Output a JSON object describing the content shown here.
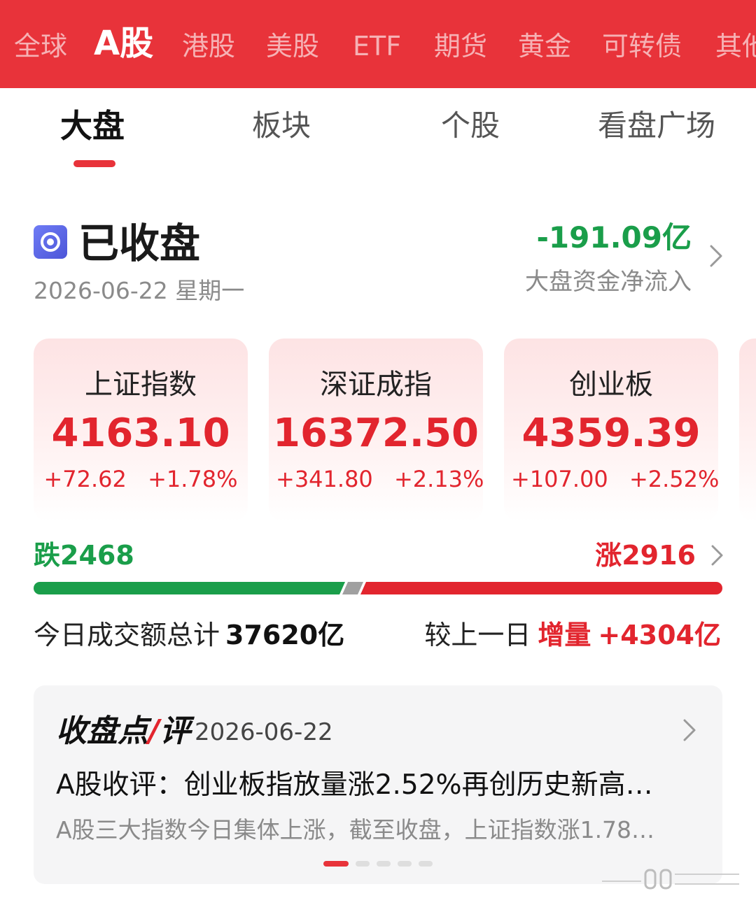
{
  "market_tabs": [
    {
      "label": "全球"
    },
    {
      "label": "A股"
    },
    {
      "label": "港股"
    },
    {
      "label": "美股"
    },
    {
      "label": "ETF"
    },
    {
      "label": "期货"
    },
    {
      "label": "黄金"
    },
    {
      "label": "可转债"
    },
    {
      "label": "其他"
    }
  ],
  "active_market_tab": "A股",
  "sub_tabs": [
    {
      "label": "大盘"
    },
    {
      "label": "板块"
    },
    {
      "label": "个股"
    },
    {
      "label": "看盘广场"
    }
  ],
  "active_sub_tab": "大盘",
  "status": {
    "title": "已收盘",
    "date": "2026-06-22 星期一",
    "icon": "record-icon"
  },
  "fund_flow": {
    "value": "-191.09亿",
    "label": "大盘资金净流入"
  },
  "indices": [
    {
      "name": "上证指数",
      "value": "4163.10",
      "change": "+72.62",
      "change_pct": "+1.78%"
    },
    {
      "name": "深证成指",
      "value": "16372.50",
      "change": "+341.80",
      "change_pct": "+2.13%"
    },
    {
      "name": "创业板",
      "value": "4359.39",
      "change": "+107.00",
      "change_pct": "+2.52%"
    }
  ],
  "breadth": {
    "fall_label": "跌2468",
    "rise_label": "涨2916",
    "fall_count": 2468,
    "rise_count": 2916
  },
  "turnover": {
    "label": "今日成交额总计",
    "value": "37620亿",
    "compare_label": "较上一日",
    "compare_tag": "增量",
    "compare_value": "+4304亿"
  },
  "review": {
    "title_part1": "收盘点",
    "title_part2": "评",
    "date": "2026-06-22",
    "headline": "A股收评：创业板指放量涨2.52%再创历史新高…",
    "summary": "A股三大指数今日集体上涨，截至收盘，上证指数涨1.78…",
    "page_count": 5,
    "active_page": 1
  },
  "colors": {
    "brand_red": "#e8333a",
    "rise_red": "#e2252e",
    "fall_green": "#1a9e4a"
  }
}
